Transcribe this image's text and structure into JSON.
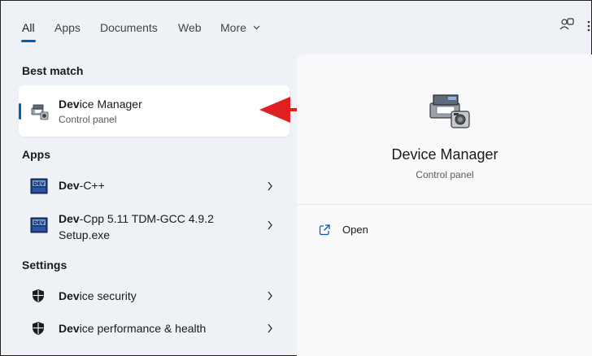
{
  "tabs": [
    {
      "label": "All"
    },
    {
      "label": "Apps"
    },
    {
      "label": "Documents"
    },
    {
      "label": "Web"
    },
    {
      "label": "More"
    }
  ],
  "sections": {
    "best_match": "Best match",
    "apps": "Apps",
    "settings": "Settings"
  },
  "best_match": {
    "title_bold": "Dev",
    "title_rest": "ice Manager",
    "subtitle": "Control panel"
  },
  "apps": [
    {
      "title_bold": "Dev",
      "title_rest": "-C++"
    },
    {
      "title_bold": "Dev",
      "title_rest": "-Cpp 5.11 TDM-GCC 4.9.2",
      "line2": "Setup.exe"
    }
  ],
  "settings": [
    {
      "title_bold": "Dev",
      "title_rest": "ice security"
    },
    {
      "title_bold": "Dev",
      "title_rest": "ice performance & health"
    }
  ],
  "preview": {
    "title": "Device Manager",
    "subtitle": "Control panel",
    "actions": [
      {
        "label": "Open"
      }
    ]
  },
  "colors": {
    "accent": "#005fb8",
    "annotation_arrow": "#e02020"
  },
  "icons": {
    "device_manager": "device-manager-icon",
    "devcpp": "devcpp-app-icon",
    "shield": "windows-security-shield-icon",
    "open": "open-external-icon"
  }
}
